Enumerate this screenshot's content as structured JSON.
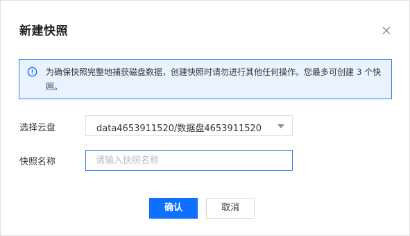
{
  "dialog": {
    "title": "新建快照",
    "close_icon": "close-icon",
    "notice": {
      "icon": "info-icon",
      "text": "为确保快照完整地捕获磁盘数据，创建快照时请勿进行其他任何操作。您最多可创建 3 个快照。",
      "colors": {
        "background": "#e8f3ff",
        "border": "#2b7fef",
        "icon": "#1a6cf5"
      }
    },
    "form": {
      "disk_label": "选择云盘",
      "disk_value": "data4653911520/数据盘4653911520",
      "name_label": "快照名称",
      "name_value": "",
      "name_placeholder": "请输入快照名称"
    },
    "buttons": {
      "confirm": "确认",
      "cancel": "取消"
    },
    "colors": {
      "primary": "#0f6fff"
    }
  }
}
